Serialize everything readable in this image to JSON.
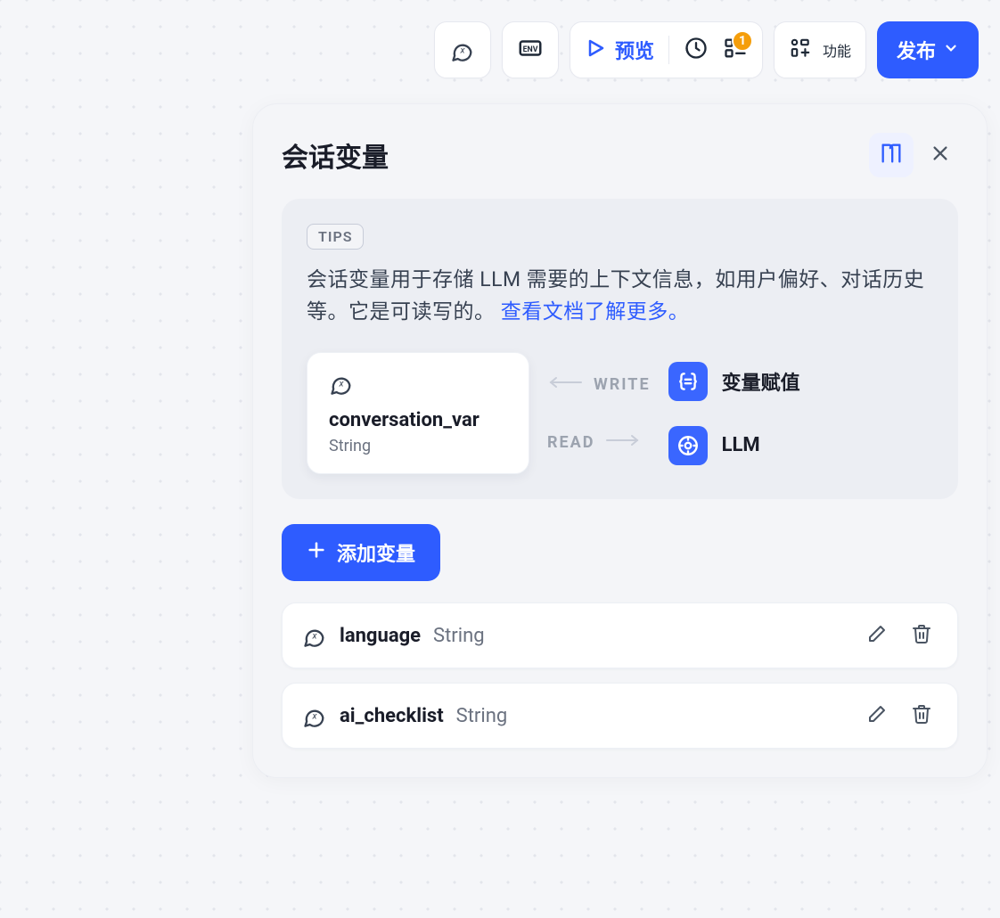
{
  "toolbar": {
    "preview_label": "预览",
    "features_label": "功能",
    "publish_label": "发布",
    "checklist_badge": "1"
  },
  "panel": {
    "title": "会话变量",
    "tips_badge": "TIPS",
    "tips_text_1": "会话变量用于存储 LLM 需要的上下文信息，如用户偏好、对话历史等。它是可读写的。",
    "tips_link": "查看文档了解更多。",
    "diagram": {
      "var_name": "conversation_var",
      "var_type": "String",
      "write_label": "WRITE",
      "read_label": "READ",
      "write_target": "变量赋值",
      "read_target": "LLM"
    },
    "add_variable_label": "添加变量"
  },
  "variables": [
    {
      "name": "language",
      "type": "String"
    },
    {
      "name": "ai_checklist",
      "type": "String"
    }
  ]
}
